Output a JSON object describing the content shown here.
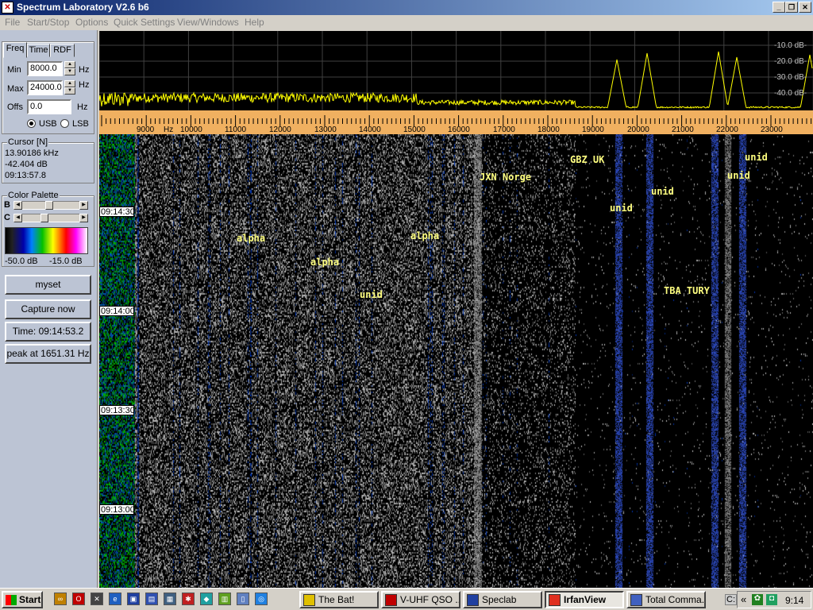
{
  "window": {
    "title": "Spectrum Laboratory V2.6 b6",
    "controls": {
      "minimize": "_",
      "restore": "❐",
      "close": "✕"
    }
  },
  "menu": [
    "File",
    "Start/Stop",
    "Options",
    "Quick Settings",
    "View/Windows",
    "Help"
  ],
  "left_panel": {
    "tabs": [
      "Freq",
      "Time",
      "RDF"
    ],
    "active_tab": "Freq",
    "min_label": "Min",
    "min_value": "8000.0",
    "min_unit": "Hz",
    "max_label": "Max",
    "max_value": "24000.0",
    "max_unit": "Hz",
    "offs_label": "Offs",
    "offs_value": "0.0",
    "offs_unit": "Hz",
    "usb_label": "USB",
    "lsb_label": "LSB",
    "sideband_selected": "USB",
    "cursor_group": "Cursor [N]",
    "cursor_freq": "13.90186 kHz",
    "cursor_db": "-42.404 dB",
    "cursor_time": "09:13:57.8",
    "palette_group": "Color Palette",
    "b_label": "B",
    "c_label": "C",
    "b_level": 0.45,
    "c_level": 0.35,
    "palette_min": "-50.0 dB",
    "palette_max": "-15.0 dB",
    "buttons": {
      "myset": "myset",
      "capture": "Capture now",
      "time": "Time:  09:14:53.2",
      "peak": "peak at 1651.31 Hz"
    }
  },
  "spectrum": {
    "db_labels": [
      "-10.0 dB-",
      "-20.0 dB-",
      "-30.0 dB-",
      "-40.0 dB-"
    ],
    "trace_color": "#ffff00"
  },
  "freq_scale": {
    "labels": [
      "9000",
      "Hz",
      "10000",
      "11000",
      "12000",
      "13000",
      "14000",
      "15000",
      "16000",
      "17000",
      "18000",
      "19000",
      "20000",
      "21000",
      "22000",
      "23000"
    ],
    "background": "#f0b060"
  },
  "waterfall": {
    "timestamps": [
      "09:14:30",
      "09:14:00",
      "09:13:30",
      "09:13:00"
    ],
    "annotations": [
      "JXN Norge",
      "GBZ UK",
      "unid",
      "unid",
      "unid",
      "unid",
      "alpha",
      "alpha",
      "alpha",
      "unid",
      "TBA TURY"
    ],
    "annotation_color": "#ffff80"
  },
  "taskbar": {
    "start": "Start",
    "tasks": [
      "The Bat!",
      "V-UHF QSO ...",
      "Speclab",
      "IrfanView",
      "Total Comma..."
    ],
    "active_task": "IrfanView",
    "tray_text": "C:",
    "tray_chevron": "«",
    "clock": "9:14"
  }
}
